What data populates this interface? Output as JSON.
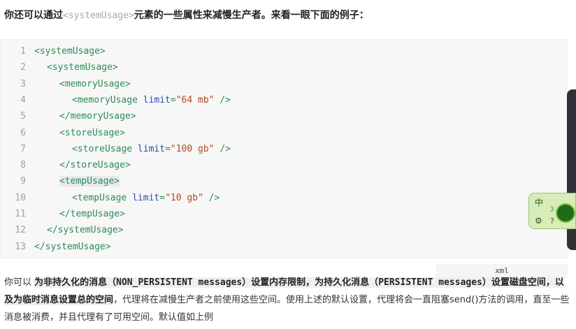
{
  "intro": {
    "before": "你还可以通过",
    "code": "<systemUsage>",
    "after": "元素的一些属性来减慢生产者。来看一眼下面的例子："
  },
  "code_lines": [
    {
      "n": "1",
      "indent": 0,
      "type": "open",
      "tag": "systemUsage"
    },
    {
      "n": "2",
      "indent": 1,
      "type": "open",
      "tag": "systemUsage"
    },
    {
      "n": "3",
      "indent": 2,
      "type": "open",
      "tag": "memoryUsage"
    },
    {
      "n": "4",
      "indent": 3,
      "type": "self",
      "tag": "memoryUsage",
      "attr": "limit",
      "val": "\"64 mb\""
    },
    {
      "n": "5",
      "indent": 2,
      "type": "close",
      "tag": "memoryUsage"
    },
    {
      "n": "6",
      "indent": 2,
      "type": "open",
      "tag": "storeUsage"
    },
    {
      "n": "7",
      "indent": 3,
      "type": "self",
      "tag": "storeUsage",
      "attr": "limit",
      "val": "\"100 gb\""
    },
    {
      "n": "8",
      "indent": 2,
      "type": "close",
      "tag": "storeUsage"
    },
    {
      "n": "9",
      "indent": 2,
      "type": "open",
      "tag": "tempUsage"
    },
    {
      "n": "10",
      "indent": 3,
      "type": "self",
      "tag": "tempUsage",
      "attr": "limit",
      "val": "\"10 gb\""
    },
    {
      "n": "11",
      "indent": 2,
      "type": "close",
      "tag": "tempUsage"
    },
    {
      "n": "12",
      "indent": 1,
      "type": "close",
      "tag": "systemUsage"
    },
    {
      "n": "13",
      "indent": 0,
      "type": "close",
      "tag": "systemUsage"
    }
  ],
  "lang_label": "xml",
  "ime": {
    "zh": "中",
    "moon": "☽",
    "gear": "⚙",
    "help": "?"
  },
  "paragraph": {
    "p1": "你可以 ",
    "b1_text": "为非持久化的消息（",
    "b1_code": "NON_PERSISTENT messages",
    "b1_rest": "）设置内存限制，为持久化消息（",
    "b1_code2": "PERSISTENT messages",
    "b1_end": "）设置磁盘空间，以及为临时消息设置总的空间",
    "p2": "，代理将在减慢生产者之前使用这些空间。使用上述的默认设置，代理将会一直阻塞send()方法的调用，直至一些消息被消费，并且代理有了可用空间。默认值如上例"
  }
}
